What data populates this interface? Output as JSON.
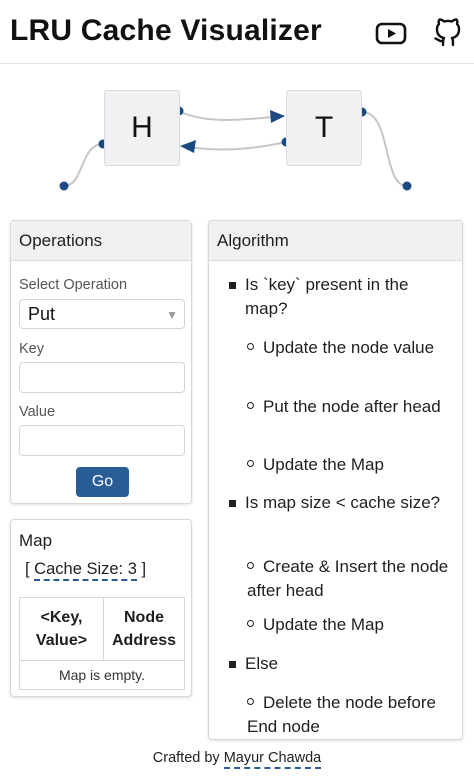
{
  "header": {
    "title": "LRU Cache Visualizer",
    "icons": [
      "youtube-icon",
      "github-icon"
    ]
  },
  "diagram": {
    "head_node": "H",
    "tail_node": "T"
  },
  "operations": {
    "title": "Operations",
    "select_label": "Select Operation",
    "select_value": "Put",
    "key_label": "Key",
    "key_value": "",
    "value_label": "Value",
    "value_value": "",
    "go_label": "Go"
  },
  "map": {
    "title": "Map",
    "cache_prefix": "[ ",
    "cache_label": "Cache Size: 3",
    "cache_suffix": " ]",
    "columns": [
      "<Key, Value>",
      "Node Address"
    ],
    "col1_line1": "<Key,",
    "col1_line2": "Value>",
    "col2_line1": "Node",
    "col2_line2": "Address",
    "empty_message": "Map is empty."
  },
  "algorithm": {
    "title": "Algorithm",
    "steps": [
      {
        "text": "Is `key` present in the map?",
        "sub": [
          "Update the node value",
          "Put the node after head",
          "Update the Map"
        ]
      },
      {
        "text": "Is map size < cache size?",
        "sub": [
          "Create & Insert the node after head",
          "Update the Map"
        ]
      },
      {
        "text": "Else",
        "sub": [
          "Delete the node before End node"
        ]
      }
    ]
  },
  "footer": {
    "prefix": "Crafted by ",
    "author": "Mayur Chawda"
  },
  "colors": {
    "accent": "#2a5d96",
    "node_fill": "#f0f1f3",
    "connector": "#1b4a80"
  }
}
